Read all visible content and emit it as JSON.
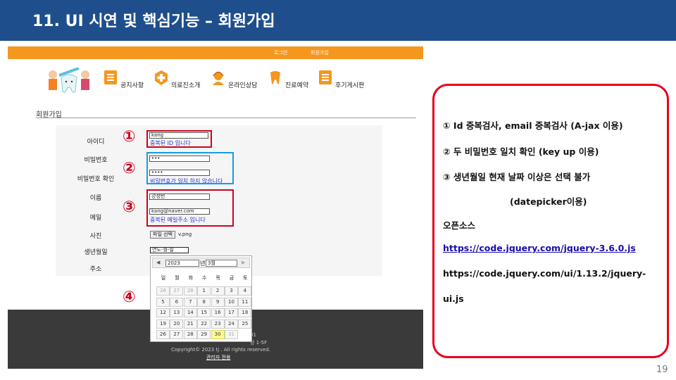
{
  "slide": {
    "title": "11. UI 시연 및 핵심기능 – 회원가입",
    "page_number": "19"
  },
  "site": {
    "top_links": [
      "로그인",
      "회원가입"
    ],
    "menu": [
      "공지사항",
      "의료진소개",
      "온라인상담",
      "진료예약",
      "후기게시판"
    ],
    "page_heading": "회원가입"
  },
  "form": {
    "labels": {
      "id": "아이디",
      "password": "비밀번호",
      "password_confirm": "비밀번호 확인",
      "name": "이름",
      "email": "메일",
      "photo": "사진",
      "birthdate": "생년월일",
      "address": "주소"
    },
    "id_value": "kang",
    "id_msg": "중복된 ID 입니다",
    "password_value": "•••",
    "password_confirm_value": "••••",
    "password_msg": "비밀번호가 일치 하지 않습니다",
    "name_value": "강성빈",
    "email_value": "kang@naver.com",
    "email_msg": "중복된 메일주소 입니다",
    "file_button": "파일 선택",
    "file_name": "v.png",
    "date_value": "연도-월-일"
  },
  "annotations": [
    "①",
    "②",
    "③",
    "④"
  ],
  "calendar": {
    "year": "2023",
    "year_suffix": "년",
    "month": "3월",
    "prev_icon": "◀",
    "next_icon": "▶",
    "weekdays": [
      "일",
      "월",
      "화",
      "수",
      "목",
      "금",
      "토"
    ],
    "weeks": [
      [
        "26",
        "27",
        "28",
        "1",
        "2",
        "3",
        "4"
      ],
      [
        "5",
        "6",
        "7",
        "8",
        "9",
        "10",
        "11"
      ],
      [
        "12",
        "13",
        "14",
        "15",
        "16",
        "17",
        "18"
      ],
      [
        "19",
        "20",
        "21",
        "22",
        "23",
        "24",
        "25"
      ],
      [
        "26",
        "27",
        "28",
        "29",
        "30",
        "31",
        ""
      ]
    ],
    "today": "30"
  },
  "footer": {
    "line1": "01",
    "line2": "당 1-5F",
    "copyright": "Copyright© 2023 tj . All rights reserved.",
    "admin_link": "관리자 전용"
  },
  "notes": {
    "line1": "①  Id 중복검사, email 중복검사 (A-jax 이용)",
    "line2": "②  두 비밀번호 일치 확인 (key up 이용)",
    "line3": "③  생년월일 현재 날짜 이상은 선택 불가",
    "line4": "(datepicker이용)",
    "line5": "오픈소스",
    "link1": "https://code.jquery.com/jquery-3.6.0.js",
    "link2_part1": "https://code.jquery.com/ui/1.13.2/jquery-",
    "link2_part2": "ui.js"
  },
  "colors": {
    "title_bar": "#1f4e8c",
    "site_header": "#f5961e",
    "annotation_red": "#d0021b",
    "annotation_blue": "#1a9be0",
    "message_blue": "#2233cc"
  }
}
